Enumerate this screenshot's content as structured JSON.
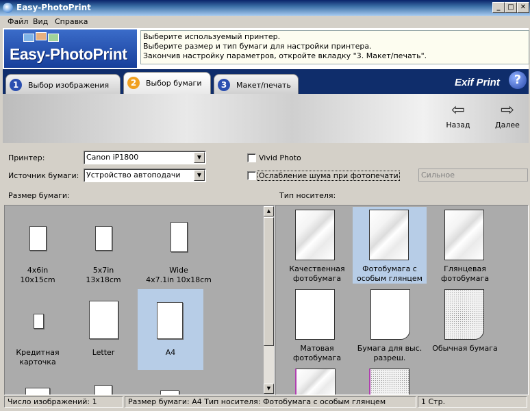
{
  "window": {
    "title": "Easy-PhotoPrint",
    "min": "_",
    "max": "□",
    "close": "✕"
  },
  "menu": [
    {
      "label": "Файл"
    },
    {
      "label": "Вид"
    },
    {
      "label": "Справка"
    }
  ],
  "header": {
    "logo_text": "Easy-PhotoPrint",
    "instructions": [
      "Выберите используемый принтер.",
      "Выберите размер и тип бумаги для настройки принтера.",
      "Закончив настройку параметров, откройте вкладку \"3. Макет/печать\"."
    ]
  },
  "tabs": [
    {
      "num": "1",
      "label": "Выбор изображения"
    },
    {
      "num": "2",
      "label": "Выбор бумаги"
    },
    {
      "num": "3",
      "label": "Макет/печать"
    }
  ],
  "brand": {
    "exif_logo": "Exif Print",
    "help": "?"
  },
  "nav": {
    "back_label": "Назад",
    "back_icon": "⇦",
    "next_label": "Далее",
    "next_icon": "⇨"
  },
  "form": {
    "printer_label": "Принтер:",
    "printer_value": "Canon iP1800",
    "source_label": "Источник бумаги:",
    "source_value": "Устройство автоподачи",
    "vivid_label": "Vivid Photo",
    "noise_label": "Ослабление шума при фотопечати",
    "noise_level": "Сильное"
  },
  "paper_size": {
    "heading": "Размер бумаги:",
    "items": [
      {
        "line1": "4x6in",
        "line2": "10x15cm"
      },
      {
        "line1": "5x7in",
        "line2": "13x18cm"
      },
      {
        "line1": "Wide",
        "line2": "4x7.1in 10x18cm"
      },
      {
        "line1": "Кредитная",
        "line2": "карточка"
      },
      {
        "line1": "Letter",
        "line2": ""
      },
      {
        "line1": "A4",
        "line2": ""
      }
    ],
    "selected": "A4"
  },
  "media_type": {
    "heading": "Тип носителя:",
    "items": [
      {
        "line1": "Качественная",
        "line2": "фотобумага"
      },
      {
        "line1": "Фотобумага с",
        "line2": "особым глянцем"
      },
      {
        "line1": "Глянцевая",
        "line2": "фотобумага"
      },
      {
        "line1": "Матовая",
        "line2": "фотобумага"
      },
      {
        "line1": "Бумага для выс.",
        "line2": "разреш."
      },
      {
        "line1": "Обычная бумага",
        "line2": ""
      }
    ],
    "selected": "Фотобумага с особым глянцем"
  },
  "statusbar": {
    "count": "Число изображений: 1",
    "summary": "Размер бумаги: A4   Тип носителя: Фотобумага с особым глянцем",
    "pages": "1 Стр."
  }
}
